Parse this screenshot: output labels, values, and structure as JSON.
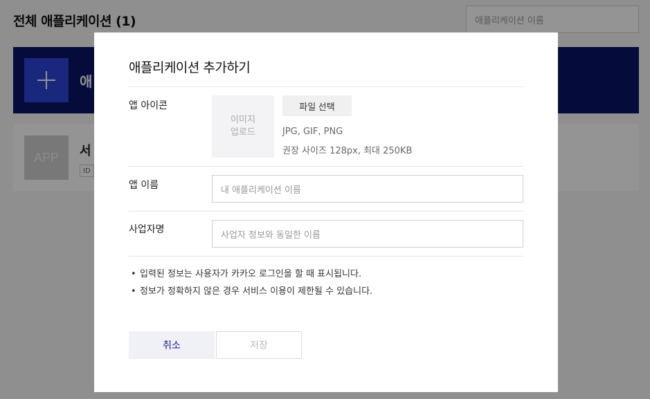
{
  "background": {
    "page_title": "전체 애플리케이션 (1)",
    "search_placeholder": "애플리케이션 이름",
    "add_card_label": "애",
    "app_card": {
      "thumb_text": "APP",
      "name": "서",
      "id_badge": "ID"
    }
  },
  "modal": {
    "title": "애플리케이션 추가하기",
    "icon_row": {
      "label": "앱 아이콘",
      "upload_line1": "이미지",
      "upload_line2": "업로드",
      "file_button": "파일 선택",
      "formats": "JPG, GIF, PNG",
      "size_hint": "권장 사이즈 128px, 최대 250KB"
    },
    "name_row": {
      "label": "앱 이름",
      "placeholder": "내 애플리케이션 이름"
    },
    "company_row": {
      "label": "사업자명",
      "placeholder": "사업자 정보와 동일한 이름"
    },
    "notes": [
      "입력된 정보는 사용자가 카카오 로그인을 할 때 표시됩니다.",
      "정보가 정확하지 않은 경우 서비스 이용이 제한될 수 있습니다."
    ],
    "cancel_label": "취소",
    "save_label": "저장"
  },
  "colors": {
    "brand_navy": "#0a1466",
    "brand_blue": "#2b46d6",
    "cancel_text": "#1a237e"
  }
}
